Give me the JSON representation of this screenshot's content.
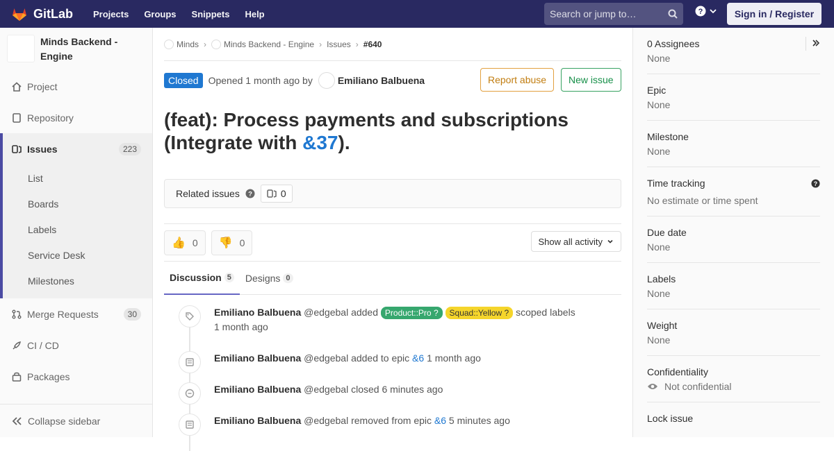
{
  "topnav": {
    "brand": "GitLab",
    "links": [
      "Projects",
      "Groups",
      "Snippets",
      "Help"
    ],
    "search_placeholder": "Search or jump to…",
    "signin": "Sign in / Register"
  },
  "sidebar": {
    "project_name": "Minds Backend - Engine",
    "items": [
      {
        "label": "Project",
        "icon": "home-icon"
      },
      {
        "label": "Repository",
        "icon": "doc-icon"
      }
    ],
    "issues": {
      "label": "Issues",
      "count": "223"
    },
    "issues_sub": [
      "List",
      "Boards",
      "Labels",
      "Service Desk",
      "Milestones"
    ],
    "merge_requests": {
      "label": "Merge Requests",
      "count": "30"
    },
    "ci_cd": "CI / CD",
    "packages": "Packages",
    "collapse": "Collapse sidebar"
  },
  "breadcrumb": [
    "Minds",
    "Minds Backend - Engine",
    "Issues",
    "#640"
  ],
  "issue": {
    "status": "Closed",
    "opened_text": "Opened 1 month ago by",
    "author": "Emiliano Balbuena",
    "report_abuse": "Report abuse",
    "new_issue": "New issue",
    "title_part1": "(feat): Process payments and subscriptions (Integrate with ",
    "title_link": "&37",
    "title_part2": ")."
  },
  "related": {
    "label": "Related issues",
    "count": "0"
  },
  "awards": {
    "thumbsup": "0",
    "thumbsdown": "0"
  },
  "activity_filter": "Show all activity",
  "tabs": [
    {
      "label": "Discussion",
      "count": "5"
    },
    {
      "label": "Designs",
      "count": "0"
    }
  ],
  "notes": [
    {
      "author": "Emiliano Balbuena",
      "handle": "@edgebal",
      "action": "added",
      "label1": "Product::Pro",
      "label2": "Squad::Yellow",
      "suffix": "scoped labels",
      "time": "1 month ago"
    },
    {
      "author": "Emiliano Balbuena",
      "handle": "@edgebal",
      "action": "added to epic",
      "link": "&6",
      "time": "1 month ago"
    },
    {
      "author": "Emiliano Balbuena",
      "handle": "@edgebal",
      "action": "closed",
      "time": "6 minutes ago"
    },
    {
      "author": "Emiliano Balbuena",
      "handle": "@edgebal",
      "action": "removed from epic",
      "link": "&6",
      "time": "5 minutes ago"
    }
  ],
  "right": {
    "assignees_title": "0 Assignees",
    "assignees_value": "None",
    "epic_title": "Epic",
    "epic_value": "None",
    "milestone_title": "Milestone",
    "milestone_value": "None",
    "time_title": "Time tracking",
    "time_value": "No estimate or time spent",
    "due_title": "Due date",
    "due_value": "None",
    "labels_title": "Labels",
    "labels_value": "None",
    "weight_title": "Weight",
    "weight_value": "None",
    "conf_title": "Confidentiality",
    "conf_value": "Not confidential",
    "lock_title": "Lock issue"
  }
}
